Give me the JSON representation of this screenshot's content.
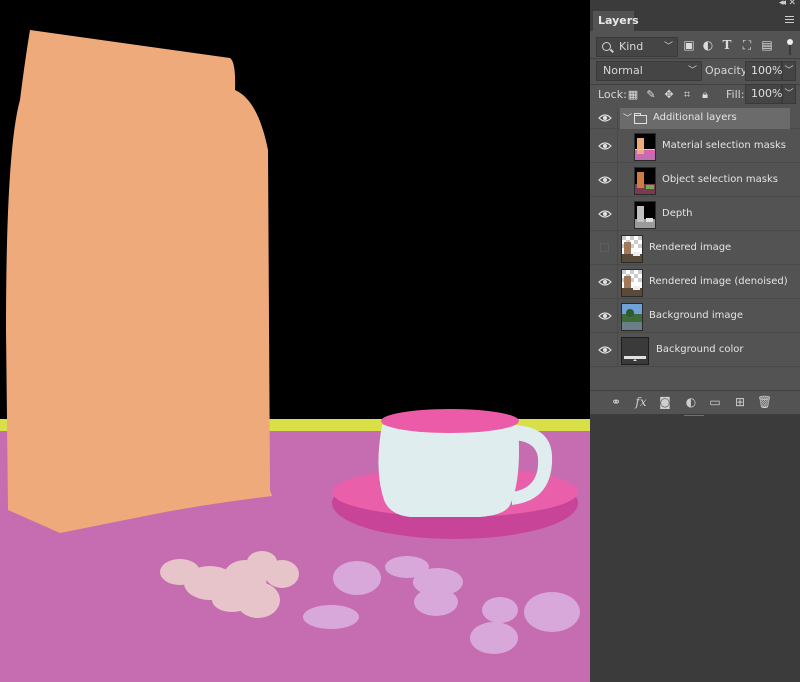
{
  "panel": {
    "tab_label": "Layers",
    "filter_kind": "Kind",
    "blend_mode": "Normal",
    "opacity_label": "Opacity:",
    "opacity_value": "100%",
    "lock_label": "Lock:",
    "fill_label": "Fill:",
    "fill_value": "100%"
  },
  "layers": [
    {
      "name": "Additional layers",
      "type": "group",
      "visible": true,
      "expanded": true
    },
    {
      "name": "Material selection masks",
      "type": "layer",
      "visible": true,
      "indented": true
    },
    {
      "name": "Object selection masks",
      "type": "layer",
      "visible": true,
      "indented": true
    },
    {
      "name": "Depth",
      "type": "layer",
      "visible": true,
      "indented": true
    },
    {
      "name": "Rendered image",
      "type": "layer",
      "visible": false
    },
    {
      "name": "Rendered image (denoised)",
      "type": "layer",
      "visible": true
    },
    {
      "name": "Background image",
      "type": "layer",
      "visible": true
    },
    {
      "name": "Background color",
      "type": "layer",
      "visible": true
    }
  ],
  "colors": {
    "canvas_background": "#000000",
    "table_surface": "#c56db0",
    "table_edge": "#d8df47",
    "bag": "#efaa7b",
    "cup": "#dfedee",
    "cup_interior": "#ec5ba7",
    "saucer": "#ea5fa9",
    "saucer_rim": "#c84498",
    "beans_pink": "#e6c4c9",
    "beans_lavender": "#d7a8d9",
    "panel_background": "#535353"
  },
  "icons": {
    "filter": [
      "image-filter-icon",
      "adjustment-filter-icon",
      "type-filter-icon",
      "shape-filter-icon",
      "smart-object-filter-icon"
    ],
    "lock": [
      "lock-transparent-icon",
      "lock-image-icon",
      "lock-position-icon",
      "lock-artboard-icon",
      "lock-all-icon"
    ],
    "footer": [
      "link-icon",
      "fx-icon",
      "mask-icon",
      "adjustment-icon",
      "group-icon",
      "new-layer-icon",
      "delete-icon"
    ]
  }
}
